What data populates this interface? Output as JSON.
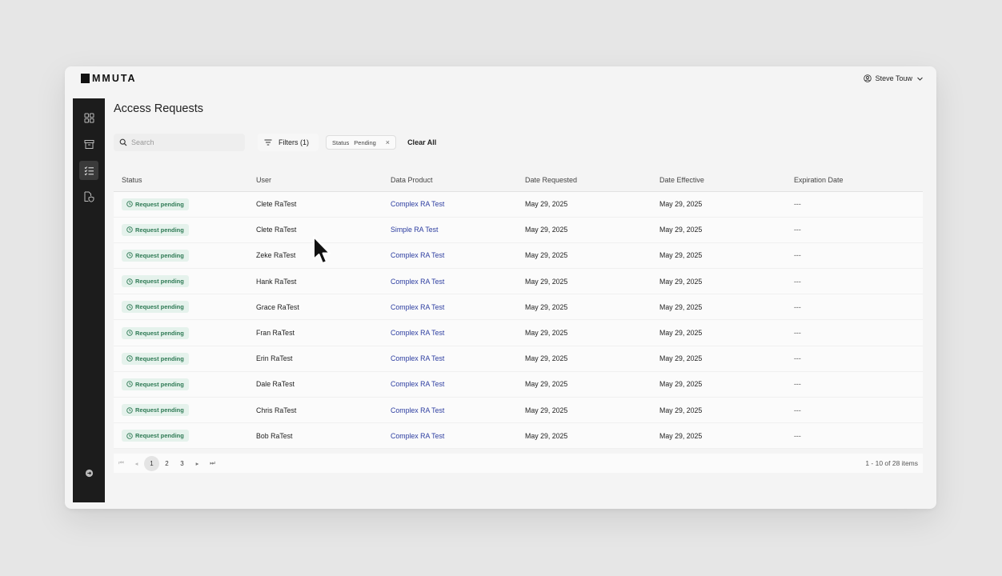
{
  "app": {
    "logo_text": "MMUTA",
    "user_name": "Steve Touw"
  },
  "sidebar": {
    "items": [
      {
        "icon": "dashboard-icon",
        "active": false
      },
      {
        "icon": "archive-icon",
        "active": false
      },
      {
        "icon": "checklist-icon",
        "active": true
      },
      {
        "icon": "document-shield-icon",
        "active": false
      }
    ],
    "bottom_icon": "arrow-right-circle-icon"
  },
  "page": {
    "title": "Access Requests"
  },
  "toolbar": {
    "search_placeholder": "Search",
    "filters_label": "Filters (1)",
    "chip_key": "Status",
    "chip_value": "Pending",
    "chip_remove": "×",
    "clear_all": "Clear All"
  },
  "table": {
    "columns": [
      "Status",
      "User",
      "Data Product",
      "Date Requested",
      "Date Effective",
      "Expiration Date"
    ],
    "rows": [
      {
        "status": "Request pending",
        "user": "Clete RaTest",
        "product": "Complex RA Test",
        "requested": "May 29, 2025",
        "effective": "May 29, 2025",
        "expiration": "---"
      },
      {
        "status": "Request pending",
        "user": "Clete RaTest",
        "product": "Simple RA Test",
        "requested": "May 29, 2025",
        "effective": "May 29, 2025",
        "expiration": "---"
      },
      {
        "status": "Request pending",
        "user": "Zeke RaTest",
        "product": "Complex RA Test",
        "requested": "May 29, 2025",
        "effective": "May 29, 2025",
        "expiration": "---"
      },
      {
        "status": "Request pending",
        "user": "Hank RaTest",
        "product": "Complex RA Test",
        "requested": "May 29, 2025",
        "effective": "May 29, 2025",
        "expiration": "---"
      },
      {
        "status": "Request pending",
        "user": "Grace RaTest",
        "product": "Complex RA Test",
        "requested": "May 29, 2025",
        "effective": "May 29, 2025",
        "expiration": "---"
      },
      {
        "status": "Request pending",
        "user": "Fran RaTest",
        "product": "Complex RA Test",
        "requested": "May 29, 2025",
        "effective": "May 29, 2025",
        "expiration": "---"
      },
      {
        "status": "Request pending",
        "user": "Erin RaTest",
        "product": "Complex RA Test",
        "requested": "May 29, 2025",
        "effective": "May 29, 2025",
        "expiration": "---"
      },
      {
        "status": "Request pending",
        "user": "Dale RaTest",
        "product": "Complex RA Test",
        "requested": "May 29, 2025",
        "effective": "May 29, 2025",
        "expiration": "---"
      },
      {
        "status": "Request pending",
        "user": "Chris RaTest",
        "product": "Complex RA Test",
        "requested": "May 29, 2025",
        "effective": "May 29, 2025",
        "expiration": "---"
      },
      {
        "status": "Request pending",
        "user": "Bob RaTest",
        "product": "Complex RA Test",
        "requested": "May 29, 2025",
        "effective": "May 29, 2025",
        "expiration": "---"
      }
    ]
  },
  "pagination": {
    "first": "⏮",
    "prev": "◂",
    "pages": [
      "1",
      "2",
      "3"
    ],
    "current": "1",
    "next": "▸",
    "last": "⏭",
    "range_text": "1 - 10 of 28 items"
  },
  "colors": {
    "sidebar_bg": "#1c1c1c",
    "badge_bg": "#e5f2ec",
    "badge_text": "#2f7a55",
    "link": "#2c3da0"
  }
}
